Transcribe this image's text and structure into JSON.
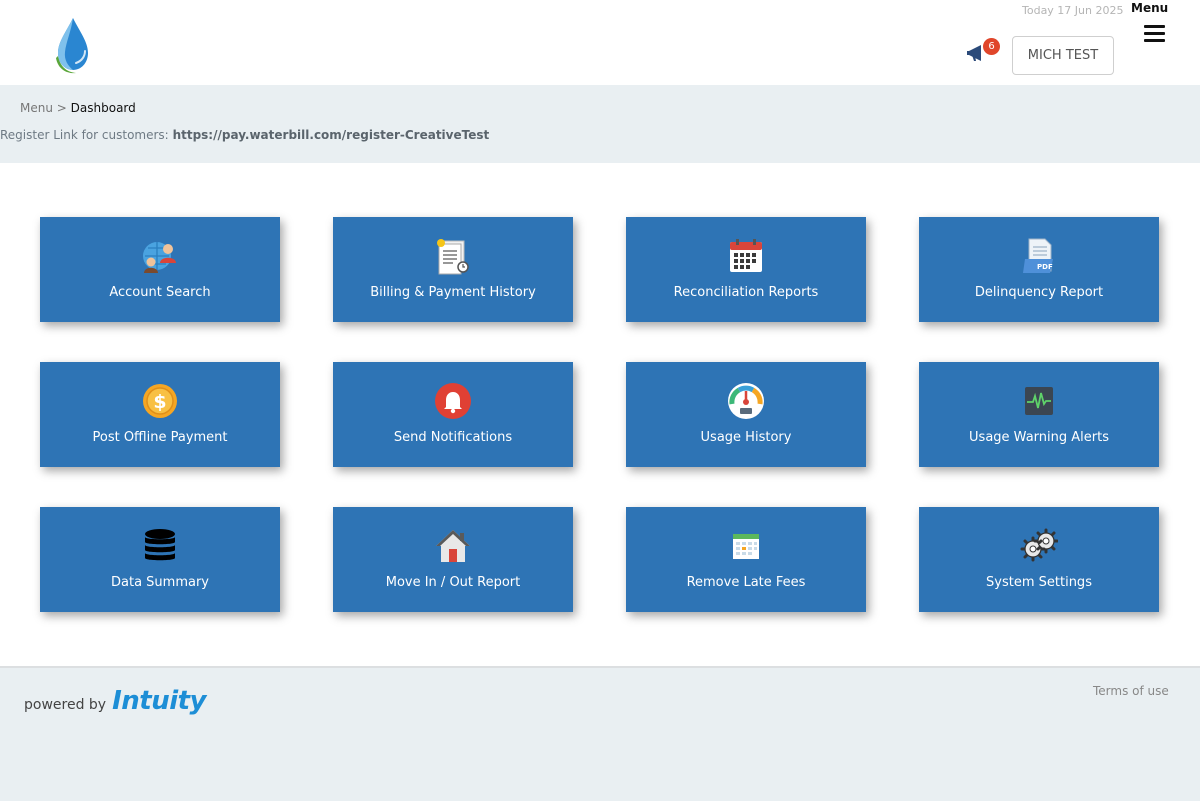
{
  "header": {
    "date": "Today 17 Jun 2025",
    "menu_label": "Menu",
    "notification_count": "6",
    "user_button": "MICH TEST"
  },
  "breadcrumb": {
    "root": "Menu",
    "separator": ">",
    "current": "Dashboard"
  },
  "register": {
    "label": "Register Link for customers:",
    "url": "https://pay.waterbill.com/register-CreativeTest"
  },
  "tiles": [
    {
      "label": "Account Search",
      "icon": "globe-users-icon"
    },
    {
      "label": "Billing & Payment History",
      "icon": "document-clock-icon"
    },
    {
      "label": "Reconciliation Reports",
      "icon": "calendar-icon"
    },
    {
      "label": "Delinquency Report",
      "icon": "pdf-document-icon"
    },
    {
      "label": "Post Offline Payment",
      "icon": "dollar-coin-icon"
    },
    {
      "label": "Send Notifications",
      "icon": "bell-icon"
    },
    {
      "label": "Usage History",
      "icon": "gauge-icon"
    },
    {
      "label": "Usage Warning Alerts",
      "icon": "heartbeat-monitor-icon"
    },
    {
      "label": "Data Summary",
      "icon": "database-icon"
    },
    {
      "label": "Move In / Out Report",
      "icon": "house-icon"
    },
    {
      "label": "Remove Late Fees",
      "icon": "calendar-grid-icon"
    },
    {
      "label": "System Settings",
      "icon": "gears-icon"
    }
  ],
  "footer": {
    "powered_by": "powered by",
    "brand": "Intuity",
    "terms": "Terms of use"
  },
  "colors": {
    "tile_bg": "#2e74b5",
    "subbar_bg": "#e9eff2",
    "badge": "#e0462b",
    "brand_blue": "#1d8ed6"
  }
}
